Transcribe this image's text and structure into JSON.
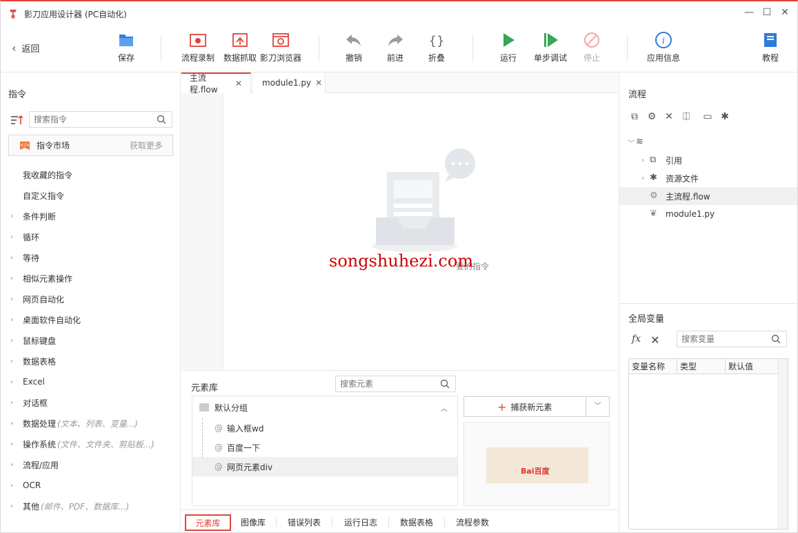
{
  "window": {
    "title": "影刀应用设计器 (PC自动化)",
    "back_label": "返回"
  },
  "toolbar": {
    "save": "保存",
    "record": "流程录制",
    "capture": "数据抓取",
    "browser": "影刀浏览器",
    "undo": "撤销",
    "redo": "前进",
    "fold": "折叠",
    "run": "运行",
    "step_debug": "单步调试",
    "stop": "停止",
    "app_info": "应用信息",
    "tutorial": "教程"
  },
  "left_panel": {
    "title": "指令",
    "search_placeholder": "搜索指令",
    "market_label": "指令市场",
    "market_more": "获取更多",
    "items": [
      {
        "label": "我收藏的指令",
        "hint": "",
        "expandable": false
      },
      {
        "label": "自定义指令",
        "hint": "",
        "expandable": false
      },
      {
        "label": "条件判断",
        "hint": "",
        "expandable": true
      },
      {
        "label": "循环",
        "hint": "",
        "expandable": true
      },
      {
        "label": "等待",
        "hint": "",
        "expandable": true
      },
      {
        "label": "相似元素操作",
        "hint": "",
        "expandable": true
      },
      {
        "label": "网页自动化",
        "hint": "",
        "expandable": true
      },
      {
        "label": "桌面软件自动化",
        "hint": "",
        "expandable": true
      },
      {
        "label": "鼠标键盘",
        "hint": "",
        "expandable": true
      },
      {
        "label": "数据表格",
        "hint": "",
        "expandable": true
      },
      {
        "label": "Excel",
        "hint": "",
        "expandable": true
      },
      {
        "label": "对话框",
        "hint": "",
        "expandable": true
      },
      {
        "label": "数据处理",
        "hint": "(文本、列表、变量...)",
        "expandable": true
      },
      {
        "label": "操作系统",
        "hint": "(文件、文件夹、剪贴板...)",
        "expandable": true
      },
      {
        "label": "流程/应用",
        "hint": "",
        "expandable": true
      },
      {
        "label": "OCR",
        "hint": "",
        "expandable": true
      },
      {
        "label": "其他",
        "hint": "(邮件、PDF、数据库...)",
        "expandable": true
      }
    ]
  },
  "editor": {
    "tabs": [
      {
        "label": "主流程.flow",
        "active": true
      },
      {
        "label": "module1.py",
        "active": false
      }
    ],
    "watermark": "songshuhezi.com",
    "empty_hint": "要的指令"
  },
  "element_library": {
    "title": "元素库",
    "search_placeholder": "搜索元素",
    "group_label": "默认分组",
    "elements": [
      "输入框wd",
      "百度一下",
      "网页元素div"
    ],
    "capture_label": "捕获新元素",
    "preview_text": "Bai百度"
  },
  "bottom_tabs": [
    "元素库",
    "图像库",
    "错误列表",
    "运行日志",
    "数据表格",
    "流程参数"
  ],
  "right_panel": {
    "flow_title": "流程",
    "tree": [
      {
        "label": "引用",
        "expandable": true
      },
      {
        "label": "资源文件",
        "expandable": true
      },
      {
        "label": "主流程.flow",
        "expandable": false,
        "selected": true
      },
      {
        "label": "module1.py",
        "expandable": false
      }
    ],
    "globals_title": "全局变量",
    "var_search_placeholder": "搜索变量",
    "var_columns": [
      "变量名称",
      "类型",
      "默认值"
    ]
  },
  "colors": {
    "accent": "#e0443a",
    "run_green": "#3aa557",
    "toolbar_blue": "#2f7bd8"
  }
}
